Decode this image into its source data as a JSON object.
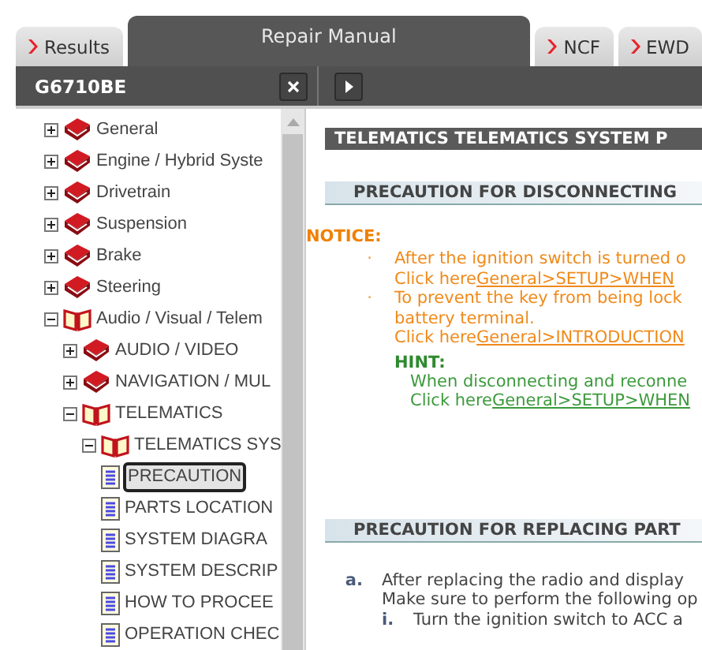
{
  "tabs": [
    {
      "label": "Results",
      "selected": false
    },
    {
      "label": "Repair Manual",
      "selected": true
    },
    {
      "label": "NCF",
      "selected": false
    },
    {
      "label": "EWD",
      "selected": false
    }
  ],
  "toolbar": {
    "title": "G6710BE"
  },
  "tree": [
    {
      "label": "General",
      "kind": "book",
      "expanded": false
    },
    {
      "label": "Engine / Hybrid Syste",
      "kind": "book",
      "expanded": false
    },
    {
      "label": "Drivetrain",
      "kind": "book",
      "expanded": false
    },
    {
      "label": "Suspension",
      "kind": "book",
      "expanded": false
    },
    {
      "label": "Brake",
      "kind": "book",
      "expanded": false
    },
    {
      "label": "Steering",
      "kind": "book",
      "expanded": false
    },
    {
      "label": "Audio / Visual / Telem",
      "kind": "book",
      "expanded": true,
      "children": [
        {
          "label": "AUDIO / VIDEO",
          "kind": "book",
          "expanded": false
        },
        {
          "label": "NAVIGATION / MUL",
          "kind": "book",
          "expanded": false
        },
        {
          "label": "TELEMATICS",
          "kind": "book",
          "expanded": true,
          "children": [
            {
              "label": "TELEMATICS SYS",
              "kind": "book",
              "expanded": true,
              "children": [
                {
                  "label": "PRECAUTION",
                  "kind": "page",
                  "selected": true
                },
                {
                  "label": "PARTS LOCATION",
                  "kind": "page",
                  "selected": false
                },
                {
                  "label": "SYSTEM DIAGRA",
                  "kind": "page",
                  "selected": false
                },
                {
                  "label": "SYSTEM DESCRIP",
                  "kind": "page",
                  "selected": false
                },
                {
                  "label": "HOW TO PROCEE",
                  "kind": "page",
                  "selected": false
                },
                {
                  "label": "OPERATION CHEC",
                  "kind": "page",
                  "selected": false
                }
              ]
            }
          ]
        }
      ]
    }
  ],
  "content": {
    "title": "TELEMATICS  TELEMATICS SYSTEM  P",
    "sections": [
      {
        "heading": "PRECAUTION FOR DISCONNECTING",
        "blocks": [
          {
            "kind": "notice",
            "label": "NOTICE:",
            "items": [
              {
                "marker": "·",
                "lines": [
                  {
                    "text": "After the ignition switch is turned o"
                  },
                  {
                    "text": "Click here",
                    "link": "General>SETUP>WHEN"
                  }
                ]
              },
              {
                "marker": "·",
                "lines": [
                  {
                    "text": "To prevent the key from being lock"
                  },
                  {
                    "text": "battery terminal."
                  },
                  {
                    "text": "Click here",
                    "link": "General>INTRODUCTION"
                  }
                ]
              }
            ]
          },
          {
            "kind": "hint",
            "label": "HINT:",
            "lines": [
              {
                "text": "When disconnecting and reconne"
              },
              {
                "text": "Click here",
                "link": "General>SETUP>WHEN"
              }
            ]
          }
        ]
      },
      {
        "heading": "PRECAUTION FOR REPLACING PART",
        "blocks": [
          {
            "kind": "steps",
            "items": [
              {
                "marker": "a.",
                "lines": [
                  {
                    "text": "After replacing the radio and display"
                  },
                  {
                    "text": "Make sure to perform the following op"
                  }
                ],
                "children": [
                  {
                    "marker": "i.",
                    "lines": [
                      {
                        "text": "Turn the ignition switch to ACC a"
                      }
                    ]
                  }
                ]
              }
            ]
          }
        ]
      }
    ]
  }
}
